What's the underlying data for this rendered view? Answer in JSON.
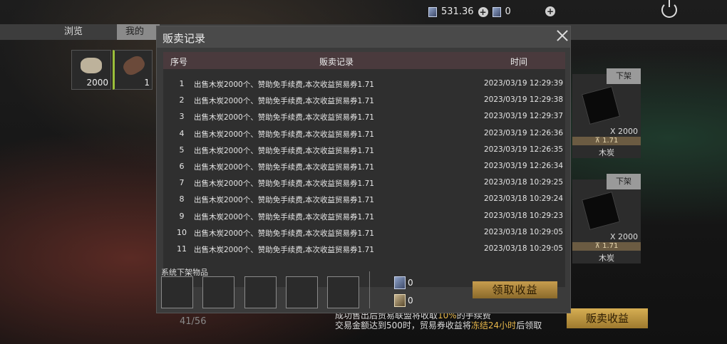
{
  "topbar": {
    "currency_amount": "531.36",
    "ticket_amount": "0"
  },
  "tabs": [
    "浏览",
    "我的"
  ],
  "inventory": [
    {
      "count": "2000"
    },
    {
      "count": "1"
    }
  ],
  "right_cards": [
    {
      "button": "下架",
      "qty": "X 2000",
      "price": "1.71",
      "name": "木炭"
    },
    {
      "button": "下架",
      "qty": "X 2000",
      "price": "1.71",
      "name": "木炭"
    }
  ],
  "dialog": {
    "title": "贩卖记录",
    "columns": {
      "index": "序号",
      "record": "贩卖记录",
      "time": "时间"
    },
    "rows": [
      {
        "index": "1",
        "record": "出售木炭2000个、赞助免手续费,本次收益贸易券1.71",
        "time": "2023/03/19 12:29:39"
      },
      {
        "index": "2",
        "record": "出售木炭2000个、赞助免手续费,本次收益贸易券1.71",
        "time": "2023/03/19 12:29:38"
      },
      {
        "index": "3",
        "record": "出售木炭2000个、赞助免手续费,本次收益贸易券1.71",
        "time": "2023/03/19 12:29:37"
      },
      {
        "index": "4",
        "record": "出售木炭2000个、赞助免手续费,本次收益贸易券1.71",
        "time": "2023/03/19 12:26:36"
      },
      {
        "index": "5",
        "record": "出售木炭2000个、赞助免手续费,本次收益贸易券1.71",
        "time": "2023/03/19 12:26:35"
      },
      {
        "index": "6",
        "record": "出售木炭2000个、赞助免手续费,本次收益贸易券1.71",
        "time": "2023/03/19 12:26:34"
      },
      {
        "index": "7",
        "record": "出售木炭2000个、赞助免手续费,本次收益贸易券1.71",
        "time": "2023/03/18 10:29:25"
      },
      {
        "index": "8",
        "record": "出售木炭2000个、赞助免手续费,本次收益贸易券1.71",
        "time": "2023/03/18 10:29:24"
      },
      {
        "index": "9",
        "record": "出售木炭2000个、赞助免手续费,本次收益贸易券1.71",
        "time": "2023/03/18 10:29:23"
      },
      {
        "index": "10",
        "record": "出售木炭2000个、赞助免手续费,本次收益贸易券1.71",
        "time": "2023/03/18 10:29:05"
      },
      {
        "index": "11",
        "record": "出售木炭2000个、赞助免手续费,本次收益贸易券1.71",
        "time": "2023/03/18 10:29:05"
      }
    ],
    "system_label": "系统下架物品",
    "ticket_a": "0",
    "ticket_b": "0",
    "collect_button": "领取收益"
  },
  "under_count": "41/56",
  "notes": {
    "line1_pre": "成功售出后贸易联盟将收取",
    "line1_hi": "10%",
    "line1_post": "的手续费",
    "line2_pre": "交易金额达到500时，贸易券收益将",
    "line2_hi": "冻结24小时",
    "line2_post": "后领取"
  },
  "sell_income_button": "贩卖收益",
  "colors": {
    "accent_gold": "#c79d4e",
    "header_row": "#4a3a3d",
    "highlight": "#e6b64a"
  }
}
